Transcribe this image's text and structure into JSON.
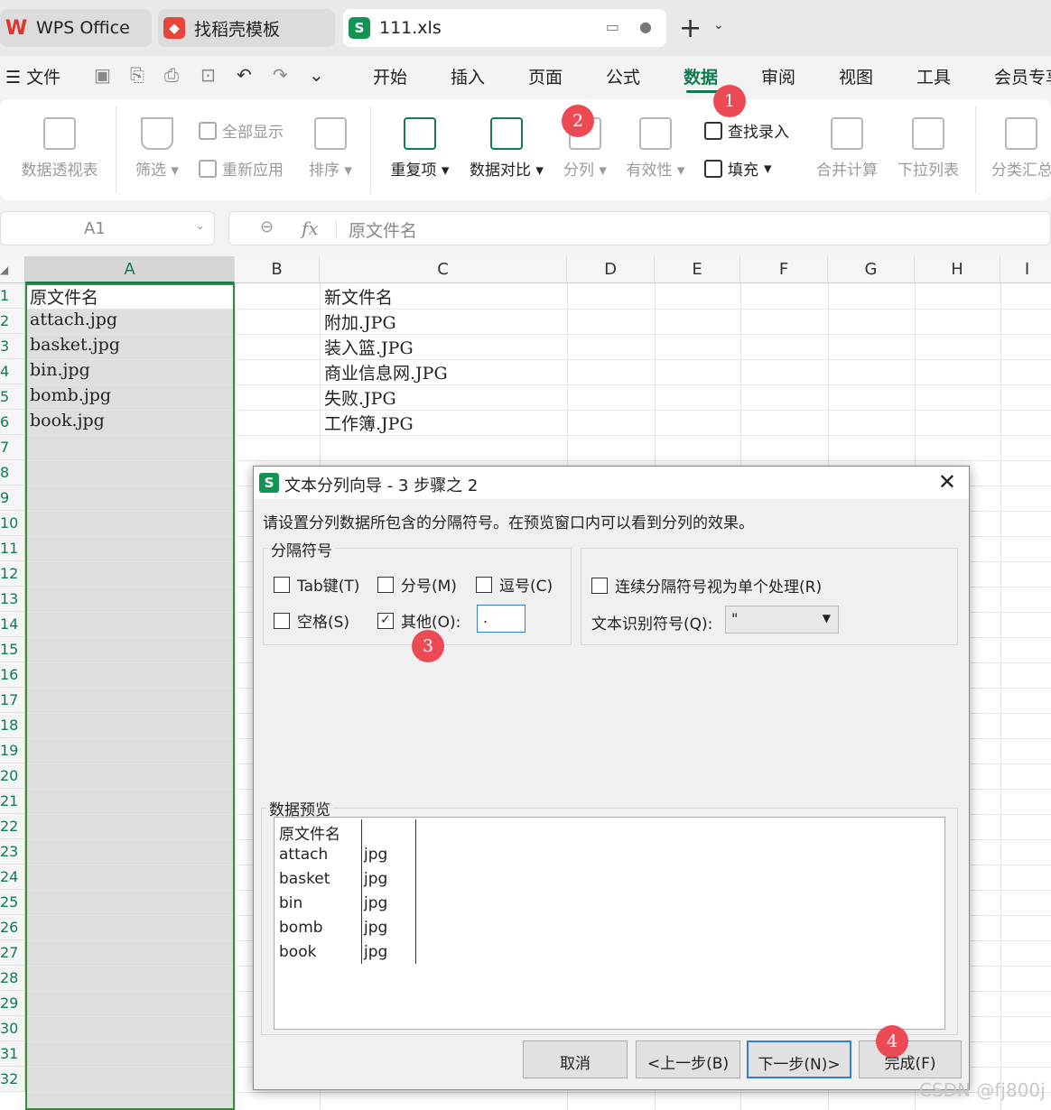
{
  "tabs": [
    {
      "label": "WPS Office",
      "icon": "wps-logo-icon"
    },
    {
      "label": "找稻壳模板",
      "icon": "docer-icon"
    },
    {
      "label": "111.xls",
      "icon": "spreadsheet-icon",
      "active": true
    }
  ],
  "menu": {
    "file": "文件",
    "items": [
      "开始",
      "插入",
      "页面",
      "公式",
      "数据",
      "审阅",
      "视图",
      "工具",
      "会员专享"
    ],
    "active": "数据"
  },
  "ribbon": {
    "pivot": "数据透视表",
    "filter": "筛选",
    "show_all": "全部显示",
    "reapply": "重新应用",
    "sort": "排序",
    "duplicates": "重复项",
    "compare": "数据对比",
    "split": "分列",
    "validity": "有效性",
    "lookup_entry": "查找录入",
    "fill": "填充",
    "consolidate": "合并计算",
    "dropdown_list": "下拉列表",
    "subtotal": "分类汇总"
  },
  "formula_bar": {
    "cell_ref": "A1",
    "fx": "fx",
    "content": "原文件名"
  },
  "sheet": {
    "columns": [
      "A",
      "B",
      "C",
      "D",
      "E",
      "F",
      "G",
      "H",
      "I"
    ],
    "rows": [
      "1",
      "2",
      "3",
      "4",
      "5",
      "6",
      "7",
      "8",
      "9",
      "10",
      "11",
      "12",
      "13",
      "14",
      "15",
      "16",
      "17",
      "18",
      "19",
      "20",
      "21",
      "22",
      "23",
      "24",
      "25",
      "26",
      "27",
      "28",
      "29",
      "30",
      "31",
      "32"
    ],
    "colA": [
      "原文件名",
      "attach.jpg",
      "basket.jpg",
      "bin.jpg",
      "bomb.jpg",
      "book.jpg"
    ],
    "colC": [
      "新文件名",
      "附加.JPG",
      "装入篮.JPG",
      "商业信息网.JPG",
      "失败.JPG",
      "工作簿.JPG"
    ]
  },
  "dialog": {
    "title": "文本分列向导 - 3 步骤之 2",
    "instruction": "请设置分列数据所包含的分隔符号。在预览窗口内可以看到分列的效果。",
    "delimiters_legend": "分隔符号",
    "tab": "Tab键(T)",
    "semicolon": "分号(M)",
    "comma": "逗号(C)",
    "space": "空格(S)",
    "other": "其他(O):",
    "other_value": ".",
    "consecutive": "连续分隔符号视为单个处理(R)",
    "text_qualifier_label": "文本识别符号(Q):",
    "text_qualifier_value": "\"",
    "preview_legend": "数据预览",
    "preview_col1": [
      "原文件名",
      "attach",
      "basket",
      "bin",
      "bomb",
      "book"
    ],
    "preview_col2": [
      "",
      "jpg",
      "jpg",
      "jpg",
      "jpg",
      "jpg"
    ],
    "buttons": {
      "cancel": "取消",
      "back": "<上一步(B)",
      "next": "下一步(N)>",
      "finish": "完成(F)"
    }
  },
  "badges": [
    "1",
    "2",
    "3",
    "4"
  ],
  "watermark": "CSDN @fj800j",
  "colors": {
    "accent": "#0f7b4e",
    "badge": "#ec4b55",
    "focus": "#2f7fd6"
  }
}
